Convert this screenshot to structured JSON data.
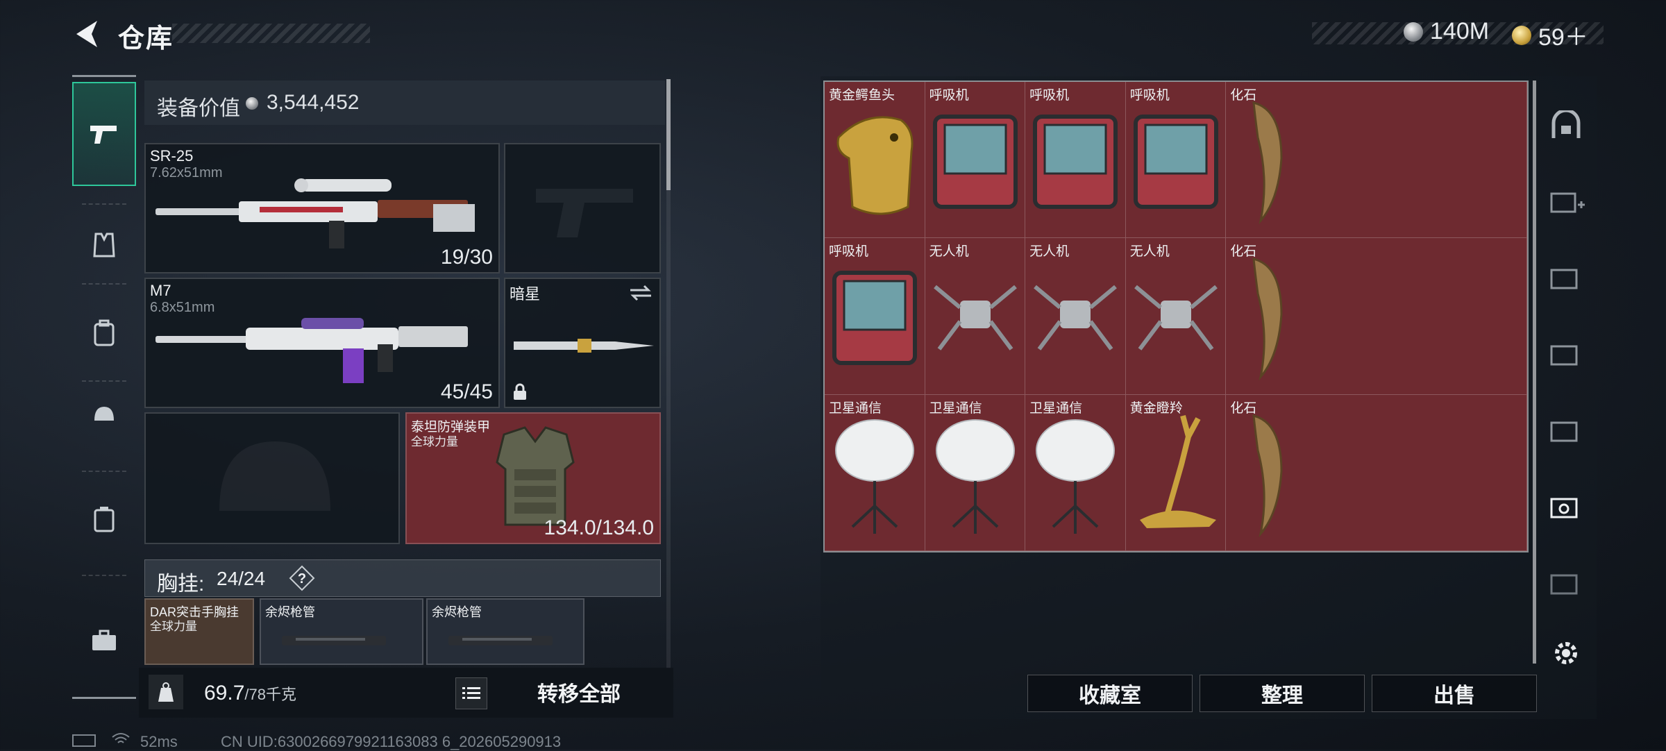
{
  "header": {
    "title": "仓库",
    "currency_silver": "140M",
    "currency_gold": "59＋"
  },
  "loadout": {
    "value_label": "装备价值",
    "value_amount": "3,544,452",
    "primary1": {
      "name": "SR-25",
      "caliber": "7.62x51mm",
      "ammo": "19/30"
    },
    "primary2": {
      "name": "M7",
      "caliber": "6.8x51mm",
      "ammo": "45/45"
    },
    "melee": {
      "name": "暗星"
    },
    "armor": {
      "name": "泰坦防弹装甲",
      "sub": "全球力量",
      "durability": "134.0/134.0"
    },
    "vest_label": "胸挂:",
    "vest_count": "24/24",
    "vest_items": [
      {
        "name": "DAR突击手胸挂",
        "sub": "全球力量"
      },
      {
        "name": "余烬枪管"
      },
      {
        "name": "余烬枪管"
      }
    ],
    "weight": "69.7",
    "weight_max": "/78千克",
    "transfer_label": "转移全部"
  },
  "storage": {
    "items": [
      {
        "name": "黄金鳄鱼头",
        "icon": "gold-croc-head"
      },
      {
        "name": "呼吸机",
        "icon": "ventilator"
      },
      {
        "name": "呼吸机",
        "icon": "ventilator"
      },
      {
        "name": "呼吸机",
        "icon": "ventilator"
      },
      {
        "name": "化石",
        "icon": "fossil-claw"
      },
      {
        "name": "呼吸机",
        "icon": "ventilator"
      },
      {
        "name": "无人机",
        "icon": "drone"
      },
      {
        "name": "无人机",
        "icon": "drone"
      },
      {
        "name": "无人机",
        "icon": "drone"
      },
      {
        "name": "化石",
        "icon": "fossil-claw"
      },
      {
        "name": "卫星通信",
        "icon": "satellite-dish"
      },
      {
        "name": "卫星通信",
        "icon": "satellite-dish"
      },
      {
        "name": "卫星通信",
        "icon": "satellite-dish"
      },
      {
        "name": "黄金瞪羚",
        "icon": "gold-gazelle"
      },
      {
        "name": "化石",
        "icon": "fossil-claw"
      }
    ],
    "actions": {
      "collection": "收藏室",
      "sort": "整理",
      "sell": "出售"
    }
  },
  "status": {
    "ping": "52ms",
    "uid": "CN UID:6300266979921163083 6_202605290913"
  },
  "colors": {
    "accent": "#2ec79a",
    "item_bg": "#6e2a30"
  }
}
